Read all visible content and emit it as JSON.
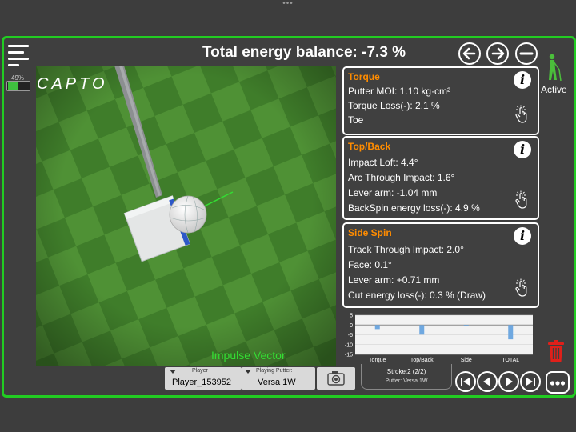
{
  "header": {
    "title": "Total energy balance: -7.3 %",
    "battery_pct": "49%",
    "battery_level": 0.49,
    "status": "Active"
  },
  "scene": {
    "logo": "CAPTO",
    "vector_label": "Impulse Vector"
  },
  "panels": {
    "torque": {
      "title": "Torque",
      "lines": [
        "Putter MOI: 1.10 kg·cm²",
        "Torque Loss(-): 2.1 %",
        "Toe"
      ]
    },
    "topback": {
      "title": "Top/Back",
      "lines": [
        "Impact Loft: 4.4°",
        "Arc Through Impact: 1.6°",
        "Lever arm: -1.04 mm",
        "BackSpin energy loss(-): 4.9 %"
      ]
    },
    "sidespin": {
      "title": "Side Spin",
      "lines": [
        "Track Through Impact: 2.0°",
        "Face: 0.1°",
        "Lever arm: +0.71 mm",
        "Cut energy loss(-): 0.3 % (Draw)"
      ]
    }
  },
  "chart_data": {
    "type": "bar",
    "categories": [
      "Torque",
      "Top/Back",
      "Side",
      "TOTAL"
    ],
    "values": [
      -2.1,
      -4.9,
      -0.3,
      -7.3
    ],
    "ylim": [
      -15,
      5
    ],
    "yticks": [
      "5",
      "0",
      "-5",
      "-10",
      "-15"
    ],
    "grid": true,
    "bar_color": "#6fa8e0"
  },
  "footer": {
    "player_label": "Player",
    "player_value": "Player_153952",
    "putter_label": "Playing Putter:",
    "putter_value": "Versa 1W",
    "stroke_text": "Stroke:2 (2/2)",
    "stroke_putter": "Putter: Versa 1W"
  },
  "colors": {
    "frame": "#22cc22",
    "accent_orange": "#ff8c00",
    "vector_green": "#33dd33",
    "trash_red": "#e0201a"
  },
  "icons": [
    "menu-icon",
    "arrow-left-icon",
    "arrow-right-icon",
    "minus-icon",
    "golfer-icon",
    "info-icon",
    "tap-hand-icon",
    "trash-icon",
    "camera-icon",
    "skip-back-icon",
    "prev-icon",
    "next-icon",
    "skip-forward-icon",
    "more-icon"
  ]
}
